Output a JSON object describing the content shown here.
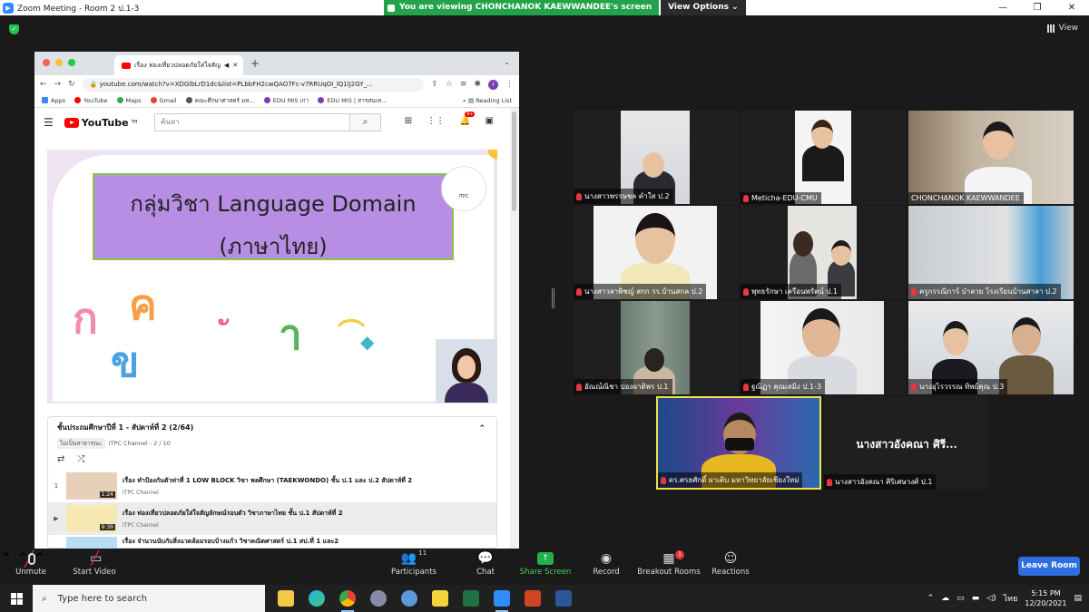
{
  "window": {
    "title": "Zoom Meeting - Room 2 ป.1-3",
    "minimize": "—",
    "maximize": "❐",
    "close": "✕"
  },
  "banner": {
    "viewing_text": "You are viewing CHONCHANOK KAEWWANDEE's screen",
    "view_options": "View Options ⌄"
  },
  "view_button": "View",
  "browser": {
    "tab_title": "เรื่อง ท่องเที่ยวปลอดภัยใส่ใจสัญ",
    "url": "youtube.com/watch?v=XDGlbLrD1dc&list=PLbbFH2cwQAO7Fc-v7RRUqOI_lQ1lJ2GY_...",
    "bookmarks": [
      "Apps",
      "YouTube",
      "Maps",
      "Gmail",
      "คณะศึกษาศาสตร์ มห...",
      "EDU MIS เก่า",
      "EDU MIS | สารสนเท..."
    ],
    "reading_list": "Reading List",
    "profile_initial": "I"
  },
  "youtube": {
    "logo": "YouTube",
    "logo_sup": "TH",
    "search_placeholder": "ค้นหา",
    "notif_count": "9+",
    "video_title_line1": "กลุ่มวิชา Language Domain",
    "video_title_line2": "(ภาษาไทย)",
    "emblem_text": "ITPC",
    "playlist": {
      "title": "ชั้นประถมศึกษาปีที่ 1 - สัปดาห์ที่ 2 (2/64)",
      "tag": "ไม่เป็นสาธารณะ",
      "channel_count": "ITPC Channel - 2 / 10",
      "items": [
        {
          "index": "1",
          "title": "เรื่อง ทำป้องกันตัวท่าที่ 1 LOW BLOCK วิชา พลศึกษา (TAEKWONDO) ชั้น ป.1 และ ป.2 สัปดาห์ที่ 2",
          "channel": "ITPC Channel",
          "duration": "1:24"
        },
        {
          "index": "▶",
          "title": "เรื่อง ท่องเที่ยวปลอดภัยใส่ใจสัญลักษณ์รอบตัว วิชาภาษาไทย ชั้น ป.1 สัปดาห์ที่ 2",
          "channel": "ITPC Channel",
          "duration": "9:39"
        },
        {
          "index": "",
          "title": "เรื่อง จำนวนนับกับสิ่งแวดล้อมรอบบ้างแก้ว วิชาคณิตศาสตร์ ป.1 สป.ที่ 1 และ2",
          "channel": "",
          "duration": ""
        }
      ]
    }
  },
  "participants": [
    {
      "name": "นางสาวพรรษชล คำใส ป.2",
      "muted": true
    },
    {
      "name": "Meticha-EDU-CMU",
      "muted": true
    },
    {
      "name": "CHONCHANOK KAEWWANDEE",
      "muted": false
    },
    {
      "name": "นางสาวลาพิชญ์ สกก รร.บ้านสกล ป.2",
      "muted": true
    },
    {
      "name": "พุทธรักษา เครือนพรัตน์ ป.1",
      "muted": true
    },
    {
      "name": "ครูกรรณิการ์ บำลาย โรงเรียนบ้านสาลา ป.2",
      "muted": true
    },
    {
      "name": "อัณณ์ณิชา  ปองผาติพร ป.1",
      "muted": true
    },
    {
      "name": "ฐณิฏา คุณเสมิง ป.1-3",
      "muted": true
    },
    {
      "name": "นางอุไรวรรณ ทิพย์คุณ ป.3",
      "muted": true
    },
    {
      "name": "ดร.ศรธศักดิ์ ผาเติบ มหาวิทยาลัยเชียงใหม่",
      "muted": true
    },
    {
      "name": "นางสาวอังคณา ศิริเศษวงศ์ ป.1",
      "muted": true,
      "display_name": "นางสาวอังคณา ศิรี..."
    }
  ],
  "toolbar": {
    "unmute": "Unmute",
    "start_video": "Start Video",
    "participants": "Participants",
    "participants_count": "11",
    "chat": "Chat",
    "share_screen": "Share Screen",
    "record": "Record",
    "breakout_rooms": "Breakout Rooms",
    "breakout_badge": "1",
    "reactions": "Reactions",
    "leave_room": "Leave Room"
  },
  "taskbar": {
    "search_placeholder": "Type here to search",
    "language": "ไทย",
    "time": "5:15 PM",
    "date": "12/20/2021"
  }
}
